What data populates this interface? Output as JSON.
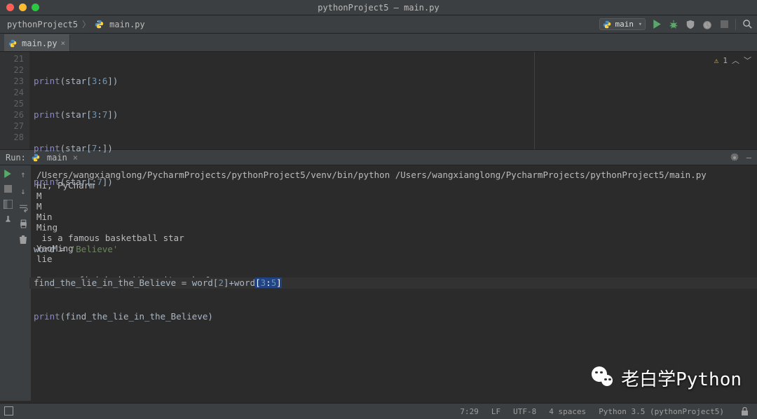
{
  "window": {
    "title": "pythonProject5 – main.py"
  },
  "breadcrumb": {
    "project": "pythonProject5",
    "file": "main.py"
  },
  "run_config": {
    "label": "main"
  },
  "tabs": [
    {
      "label": "main.py"
    }
  ],
  "inspection": {
    "warn_icon": "⚠",
    "count": "1",
    "up": "︿",
    "down": "﹀"
  },
  "code": {
    "lines": [
      "21",
      "22",
      "23",
      "24",
      "25",
      "26",
      "27",
      "28"
    ],
    "l21": {
      "fn": "print",
      "id": "star",
      "a": "3",
      "b": "6"
    },
    "l22": {
      "fn": "print",
      "id": "star",
      "a": "3",
      "b": "7"
    },
    "l23": {
      "fn": "print",
      "id": "star",
      "a": "7",
      "b": ""
    },
    "l24": {
      "fn": "print",
      "id": "star",
      "a": "",
      "b": "7"
    },
    "l26": {
      "kw": "word",
      "op": "=",
      "str": "'Believe'"
    },
    "l27": {
      "var": "find_the_lie_in_the_Believe",
      "op": "=",
      "w": "word",
      "i": "2",
      "plus": "+",
      "a": "3",
      "b": "5"
    },
    "l28": {
      "fn": "print",
      "arg": "find_the_lie_in_the_Believe"
    }
  },
  "run": {
    "label": "Run:",
    "name": "main",
    "close": "×",
    "output": "/Users/wangxianglong/PycharmProjects/pythonProject5/venv/bin/python /Users/wangxianglong/PycharmProjects/pythonProject5/main.py\nHi, PyCharm\nM\nM\nMin\nMing\n is a famous basketball star\nYaoMing\nlie\n\nProcess finished with exit code 0"
  },
  "status": {
    "pos": "7:29",
    "sep": "LF",
    "enc": "UTF-8",
    "indent": "4 spaces",
    "interp": "Python 3.5 (pythonProject5)"
  },
  "watermark": {
    "text": "老白学Python"
  }
}
